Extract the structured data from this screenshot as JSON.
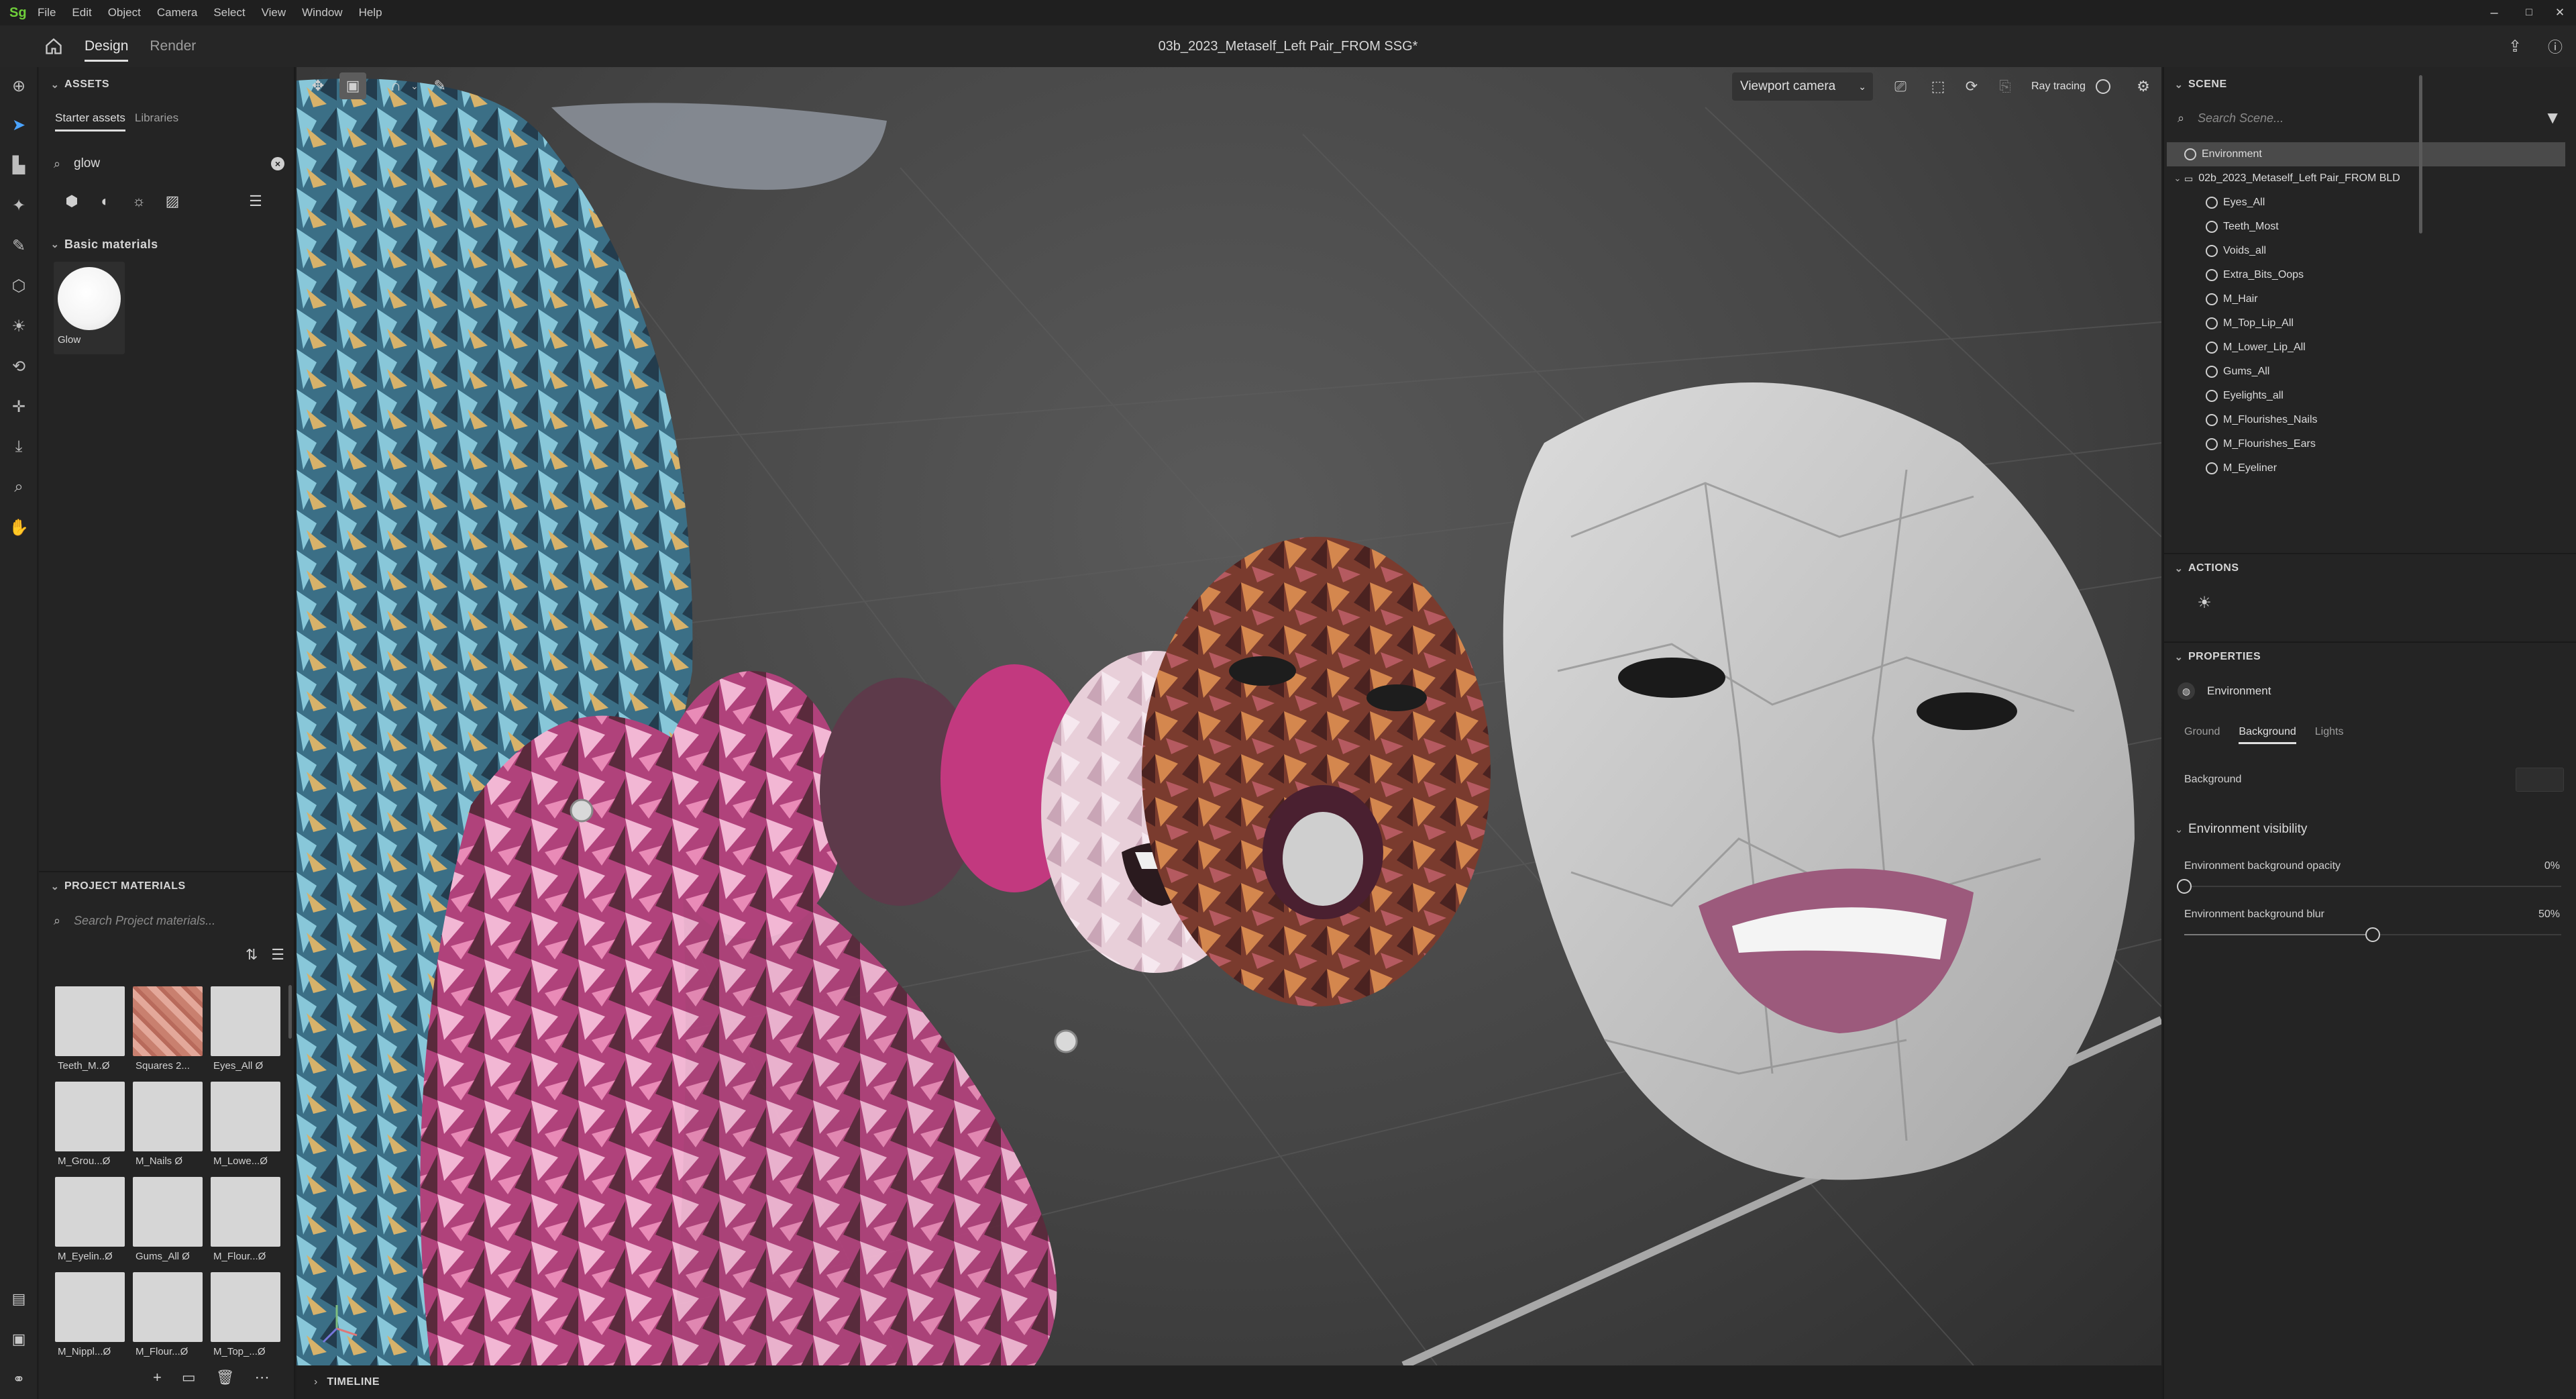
{
  "menubar": {
    "logo": "Sg",
    "items": [
      "File",
      "Edit",
      "Object",
      "Camera",
      "Select",
      "View",
      "Window",
      "Help"
    ],
    "window_controls": {
      "minimize": "–",
      "maximize": "□",
      "close": "✕"
    }
  },
  "header": {
    "tabs": [
      "Design",
      "Render"
    ],
    "active_tab": "Design",
    "title": "03b_2023_Metaself_Left Pair_FROM SSG*"
  },
  "assets": {
    "section_title": "ASSETS",
    "tabs": [
      "Starter assets",
      "Libraries"
    ],
    "search_value": "glow",
    "group_title": "Basic materials",
    "materials": [
      {
        "name": "Glow"
      }
    ]
  },
  "project_materials": {
    "section_title": "PROJECT MATERIALS",
    "search_placeholder": "Search Project materials...",
    "items": [
      {
        "label": "Teeth_M..Ø",
        "pattern": false
      },
      {
        "label": "Squares 2...",
        "pattern": true
      },
      {
        "label": "Eyes_All Ø",
        "pattern": false
      },
      {
        "label": "M_Grou...Ø",
        "pattern": false
      },
      {
        "label": "M_Nails Ø",
        "pattern": false
      },
      {
        "label": "M_Lowe...Ø",
        "pattern": false
      },
      {
        "label": "M_Eyelin..Ø",
        "pattern": false
      },
      {
        "label": "Gums_All Ø",
        "pattern": false
      },
      {
        "label": "M_Flour...Ø",
        "pattern": false
      },
      {
        "label": "M_Nippl...Ø",
        "pattern": false
      },
      {
        "label": "M_Flour...Ø",
        "pattern": false
      },
      {
        "label": "M_Top_...Ø",
        "pattern": false
      }
    ]
  },
  "viewport": {
    "camera_label": "Viewport camera",
    "ray_tracing_label": "Ray tracing"
  },
  "timeline": {
    "label": "TIMELINE"
  },
  "scene": {
    "section_title": "SCENE",
    "search_placeholder": "Search Scene...",
    "tree": [
      {
        "label": "Environment",
        "level": 0,
        "selected": true,
        "kind": "env"
      },
      {
        "label": "02b_2023_Metaself_Left Pair_FROM BLD",
        "level": 0,
        "selected": false,
        "kind": "group"
      },
      {
        "label": "Eyes_All",
        "level": 1,
        "selected": false,
        "kind": "mesh"
      },
      {
        "label": "Teeth_Most",
        "level": 1,
        "selected": false,
        "kind": "mesh"
      },
      {
        "label": "Voids_all",
        "level": 1,
        "selected": false,
        "kind": "mesh"
      },
      {
        "label": "Extra_Bits_Oops",
        "level": 1,
        "selected": false,
        "kind": "mesh"
      },
      {
        "label": "M_Hair",
        "level": 1,
        "selected": false,
        "kind": "mesh"
      },
      {
        "label": "M_Top_Lip_All",
        "level": 1,
        "selected": false,
        "kind": "mesh"
      },
      {
        "label": "M_Lower_Lip_All",
        "level": 1,
        "selected": false,
        "kind": "mesh"
      },
      {
        "label": "Gums_All",
        "level": 1,
        "selected": false,
        "kind": "mesh"
      },
      {
        "label": "Eyelights_all",
        "level": 1,
        "selected": false,
        "kind": "mesh"
      },
      {
        "label": "M_Flourishes_Nails",
        "level": 1,
        "selected": false,
        "kind": "mesh"
      },
      {
        "label": "M_Flourishes_Ears",
        "level": 1,
        "selected": false,
        "kind": "mesh"
      },
      {
        "label": "M_Eyeliner",
        "level": 1,
        "selected": false,
        "kind": "mesh"
      }
    ]
  },
  "actions": {
    "section_title": "ACTIONS"
  },
  "properties": {
    "section_title": "PROPERTIES",
    "target": "Environment",
    "tabs": [
      "Ground",
      "Background",
      "Lights"
    ],
    "active_tab": "Background",
    "background_label": "Background",
    "visibility_title": "Environment visibility",
    "opacity": {
      "label": "Environment background opacity",
      "value_text": "0%",
      "value": 0
    },
    "blur": {
      "label": "Environment background blur",
      "value_text": "50%",
      "value": 0.5
    }
  }
}
